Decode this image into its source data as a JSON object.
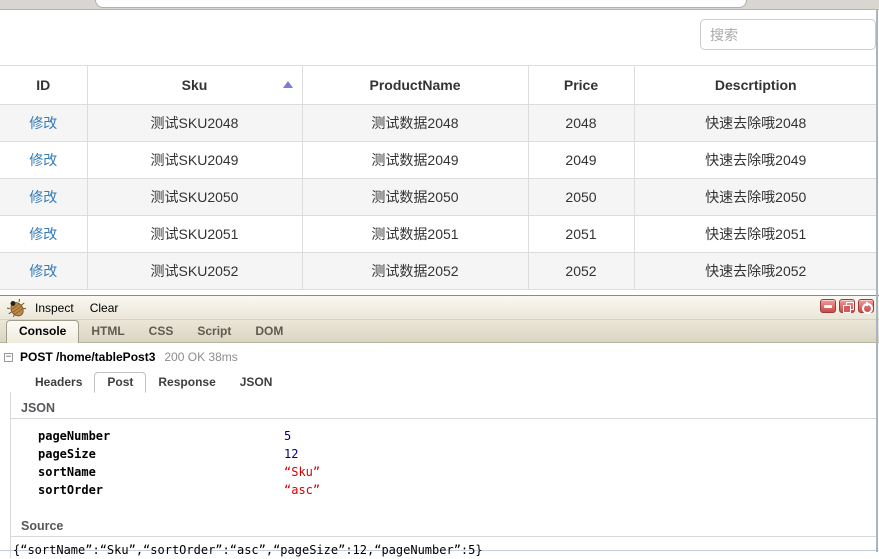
{
  "search": {
    "placeholder": "搜索"
  },
  "table": {
    "headers": [
      "ID",
      "Sku",
      "ProductName",
      "Price",
      "Descrtiption"
    ],
    "sort": {
      "column": "Sku",
      "order": "asc"
    },
    "rows": [
      [
        "修改",
        "测试SKU2048",
        "测试数据2048",
        "2048",
        "快速去除哦2048"
      ],
      [
        "修改",
        "测试SKU2049",
        "测试数据2049",
        "2049",
        "快速去除哦2049"
      ],
      [
        "修改",
        "测试SKU2050",
        "测试数据2050",
        "2050",
        "快速去除哦2050"
      ],
      [
        "修改",
        "测试SKU2051",
        "测试数据2051",
        "2051",
        "快速去除哦2051"
      ],
      [
        "修改",
        "测试SKU2052",
        "测试数据2052",
        "2052",
        "快速去除哦2052"
      ]
    ]
  },
  "firebug": {
    "toolbar": {
      "inspect_label": "Inspect",
      "clear_label": "Clear"
    },
    "tabs": [
      "Console",
      "HTML",
      "CSS",
      "Script",
      "DOM"
    ],
    "active_tab": "Console",
    "request": {
      "method_path": "POST /home/tablePost3",
      "status": "200 OK 38ms"
    },
    "subtabs": [
      "Headers",
      "Post",
      "Response",
      "JSON"
    ],
    "active_subtab": "Post",
    "json_panel": {
      "title": "JSON",
      "entries": [
        {
          "key": "pageNumber",
          "value": "5",
          "kind": "number"
        },
        {
          "key": "pageSize",
          "value": "12",
          "kind": "number"
        },
        {
          "key": "sortName",
          "value": "“Sku”",
          "kind": "string"
        },
        {
          "key": "sortOrder",
          "value": "“asc”",
          "kind": "string"
        }
      ]
    },
    "source_panel": {
      "title": "Source",
      "text": "{“sortName”:“Sku”,“sortOrder”:“asc”,“pageSize”:12,“pageNumber”:5}"
    }
  },
  "colors": {
    "link": "#337ab7",
    "sort_caret": "#7b7bd8",
    "json_number": "#000080",
    "json_string": "#d40000",
    "firebug_beige": "#eae6d8",
    "window_button_red": "#cc4a4a",
    "stripe_row": "#f5f5f5"
  }
}
